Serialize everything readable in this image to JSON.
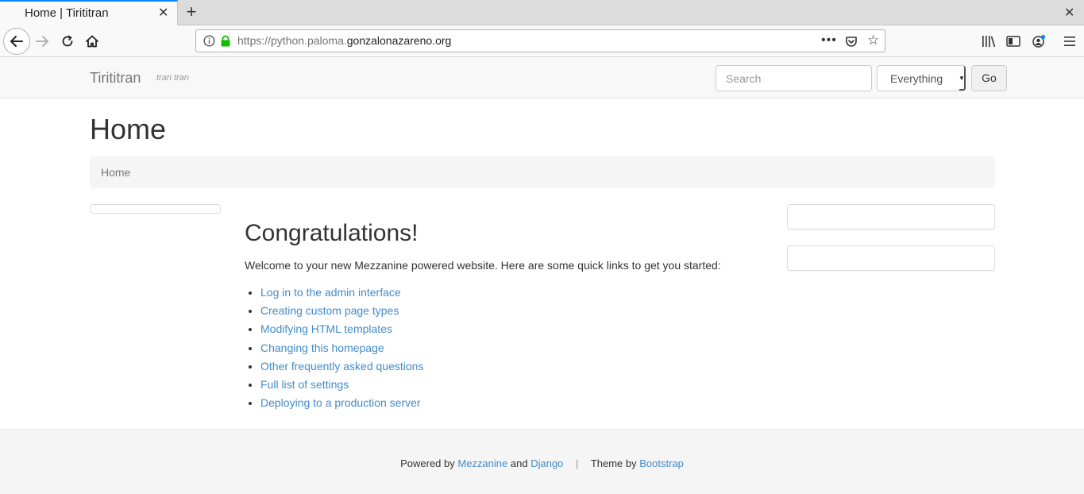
{
  "browser": {
    "tab_title": "Home | Tirititran",
    "url_prefix": "https://python.paloma.",
    "url_domain": "gonzalonazareno.org",
    "icons": [
      "back-arrow-icon",
      "forward-arrow-icon",
      "reload-icon",
      "home-icon",
      "info-icon",
      "lock-icon",
      "pocket-icon",
      "star-icon",
      "library-icon",
      "sidebar-icon",
      "sync-icon",
      "menu-icon"
    ],
    "accent_color": "#0a84ff"
  },
  "header": {
    "brand": "Tirititran",
    "tagline": "tran tran",
    "search_placeholder": "Search",
    "search_scope": "Everything",
    "go_label": "Go"
  },
  "page": {
    "title": "Home",
    "breadcrumb": "Home"
  },
  "content": {
    "heading": "Congratulations!",
    "intro": "Welcome to your new Mezzanine powered website. Here are some quick links to get you started:",
    "links": [
      "Log in to the admin interface",
      "Creating custom page types",
      "Modifying HTML templates",
      "Changing this homepage",
      "Other frequently asked questions",
      "Full list of settings",
      "Deploying to a production server"
    ],
    "link_color": "#428bca"
  },
  "footer": {
    "powered_by": "Powered by",
    "mezzanine": "Mezzanine",
    "and": "and",
    "django": "Django",
    "separator": "|",
    "theme_by": "Theme by",
    "bootstrap": "Bootstrap"
  }
}
